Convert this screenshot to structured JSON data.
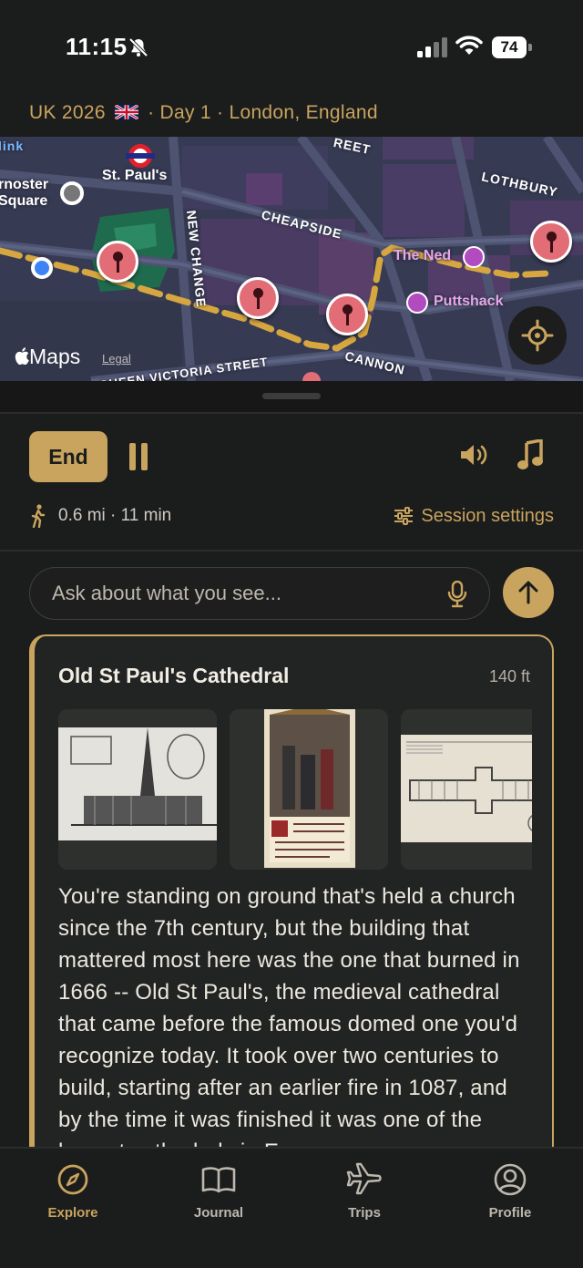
{
  "status_bar": {
    "time": "11:15",
    "battery": "74"
  },
  "trip": {
    "name": "UK 2026",
    "day": "Day 1",
    "location": "London, England"
  },
  "map": {
    "labels": {
      "elizabeth_line": "link",
      "paternoster_line1": "rnoster",
      "paternoster_line2": "Square",
      "st_pauls": "St. Paul's",
      "street_top": "REET",
      "lothbury": "LOTHBURY",
      "cheapside": "CHEAPSIDE",
      "new_change": "NEW CHANGE",
      "the_ned": "The Ned",
      "puttshack": "Puttshack",
      "cannon": "CANNON",
      "queen_victoria": "QUEEN VICTORIA STREET"
    },
    "attribution": "Maps",
    "legal": "Legal",
    "colors": {
      "route": "#d6a640",
      "pin": "#e36d76",
      "poi": "#b24bc0"
    }
  },
  "controls": {
    "end_label": "End",
    "walk_distance": "0.6 mi · 11 min",
    "session_settings_label": "Session settings"
  },
  "ask": {
    "placeholder": "Ask about what you see..."
  },
  "card": {
    "title": "Old St Paul's Cathedral",
    "distance": "140 ft",
    "body": "You're standing on ground that's held a church since the 7th century, but the building that mattered most here was the one that burned in 1666 -- Old St Paul's, the medieval cathedral that came before the famous domed one you'd recognize today. It took over two centuries to build, starting after an earlier fire in 1087, and by the time it was finished it was one of the largest cathedrals in Europe."
  },
  "tabs": [
    {
      "label": "Explore",
      "icon": "compass-icon",
      "active": true
    },
    {
      "label": "Journal",
      "icon": "book-icon",
      "active": false
    },
    {
      "label": "Trips",
      "icon": "plane-icon",
      "active": false
    },
    {
      "label": "Profile",
      "icon": "person-circle-icon",
      "active": false
    }
  ],
  "accent_color": "#c9a45e"
}
